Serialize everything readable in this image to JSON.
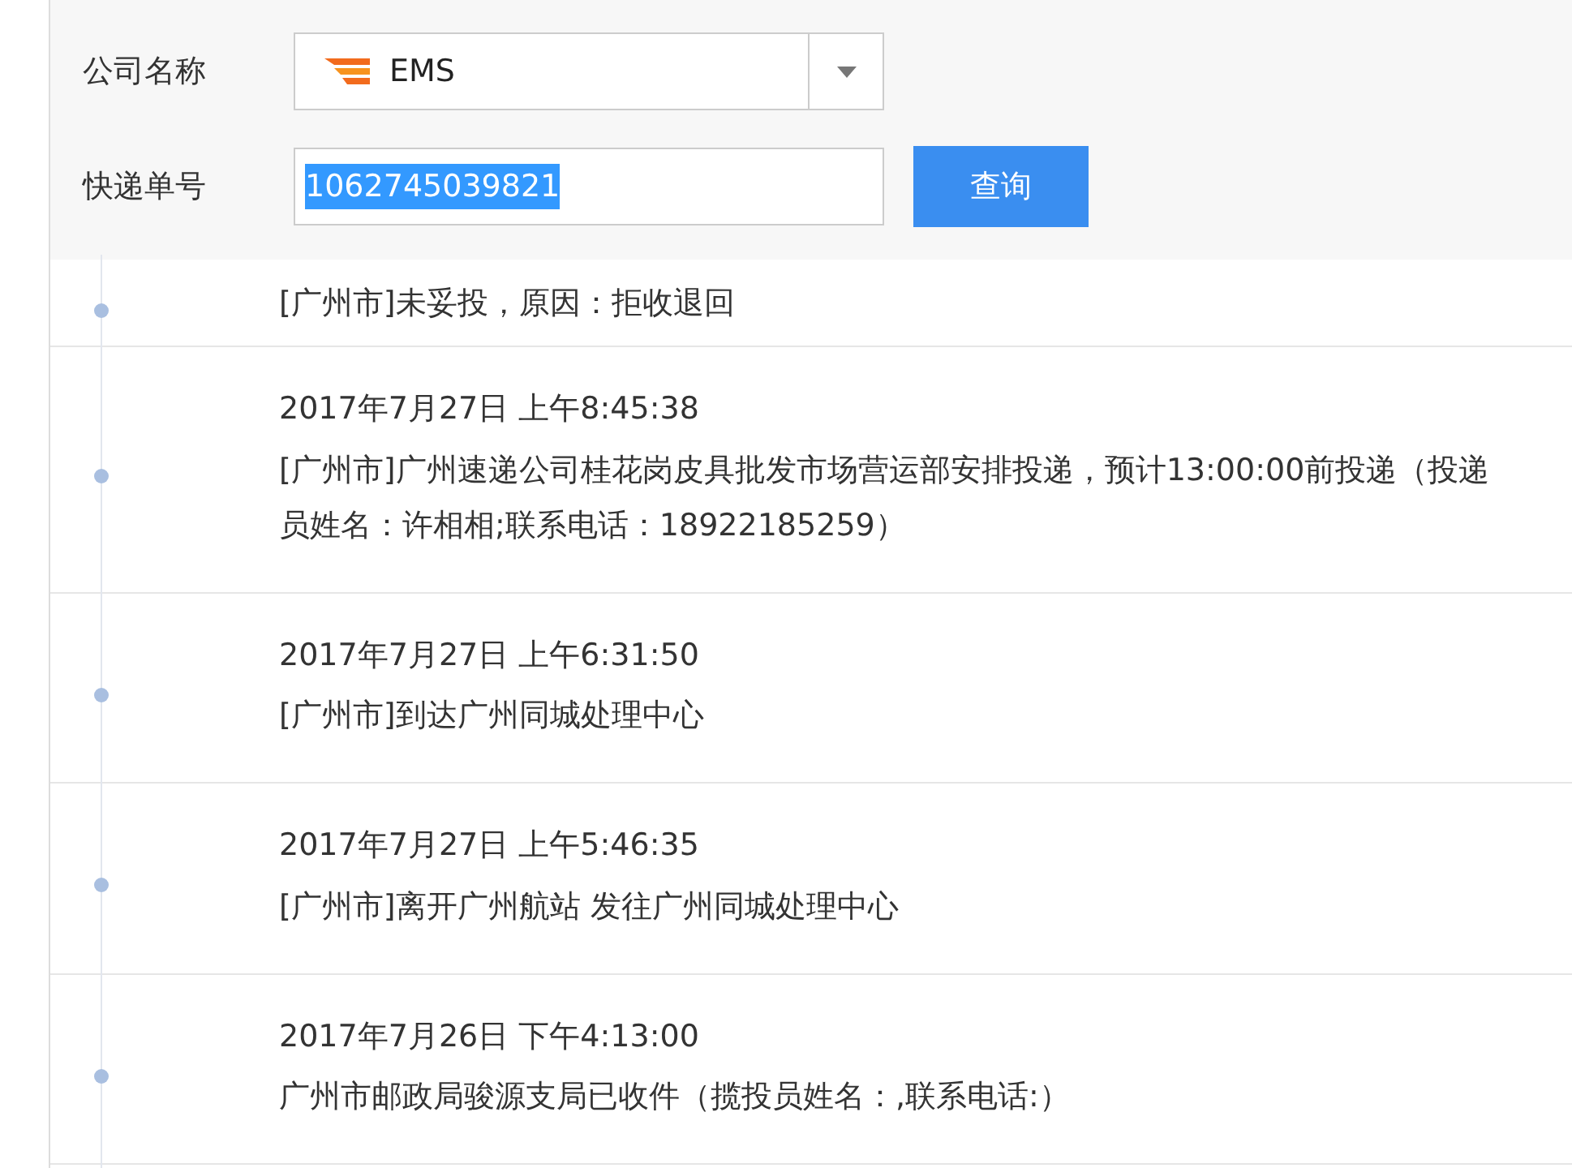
{
  "form": {
    "company_label": "公司名称",
    "company_value": "EMS",
    "number_label": "快递单号",
    "number_value": "1062745039821",
    "number_text_selected": true,
    "query_button": "查询"
  },
  "records": [
    {
      "message": "[广州市]未妥投，原因：拒收退回"
    },
    {
      "time": "2017年7月27日 上午8:45:38",
      "message": "[广州市]广州速递公司桂花岗皮具批发市场营运部安排投递，预计13:00:00前投递（投递员姓名：许相相;联系电话：18922185259）"
    },
    {
      "time": "2017年7月27日 上午6:31:50",
      "message": "[广州市]到达广州同城处理中心"
    },
    {
      "time": "2017年7月27日 上午5:46:35",
      "message": "[广州市]离开广州航站 发往广州同城处理中心"
    },
    {
      "time": "2017年7月26日 下午4:13:00",
      "message": "广州市邮政局骏源支局已收件（揽投员姓名：,联系电话:）"
    }
  ]
}
